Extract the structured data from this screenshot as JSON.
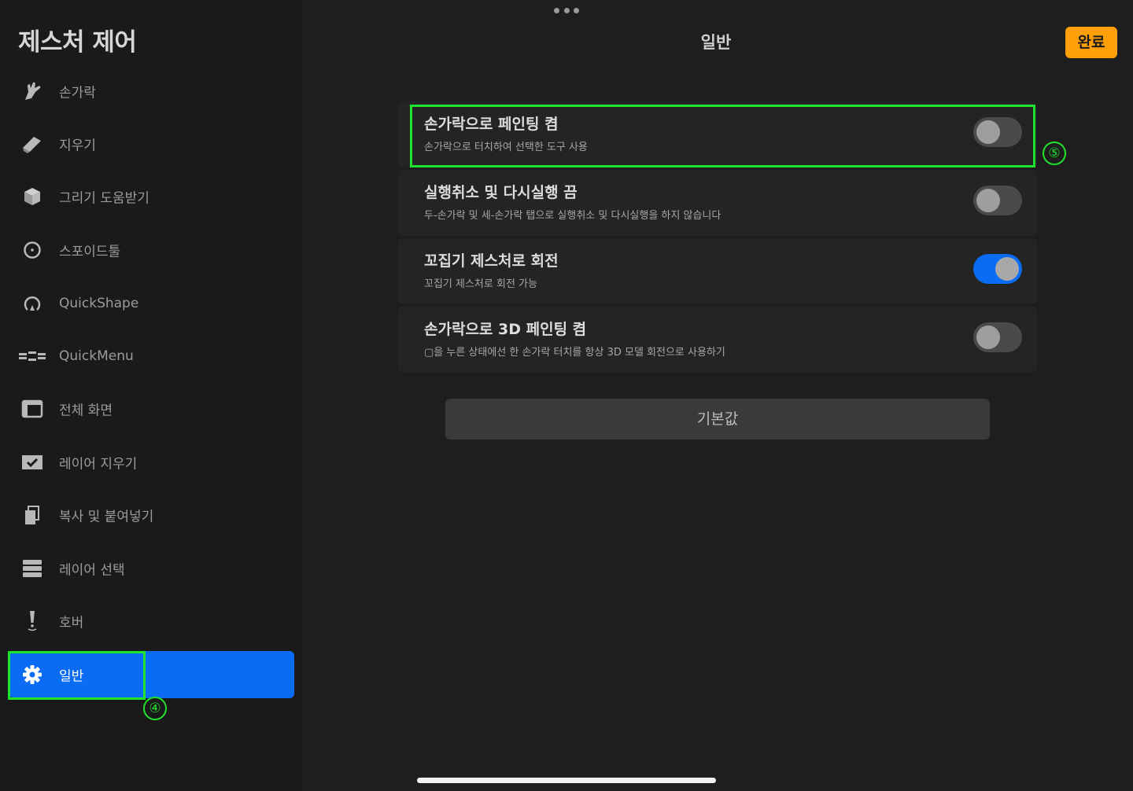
{
  "sidebar": {
    "title": "제스처 제어",
    "items": [
      {
        "label": "손가락",
        "icon": "finger-icon"
      },
      {
        "label": "지우기",
        "icon": "eraser-icon"
      },
      {
        "label": "그리기 도움받기",
        "icon": "cube-icon"
      },
      {
        "label": "스포이드툴",
        "icon": "eyedropper-circle-icon"
      },
      {
        "label": "QuickShape",
        "icon": "quickshape-icon"
      },
      {
        "label": "QuickMenu",
        "icon": "quickmenu-icon"
      },
      {
        "label": "전체 화면",
        "icon": "fullscreen-icon"
      },
      {
        "label": "레이어 지우기",
        "icon": "clear-layer-icon"
      },
      {
        "label": "복사 및 붙여넣기",
        "icon": "copy-paste-icon"
      },
      {
        "label": "레이어 선택",
        "icon": "layers-icon"
      },
      {
        "label": "호버",
        "icon": "hover-pencil-icon"
      },
      {
        "label": "일반",
        "icon": "gear-icon",
        "active": true
      }
    ]
  },
  "header": {
    "title": "일반",
    "done_label": "완료"
  },
  "settings": [
    {
      "title": "손가락으로 페인팅 켬",
      "description": "손가락으로 터치하여 선택한 도구 사용",
      "on": false
    },
    {
      "title": "실행취소 및 다시실행 끔",
      "description": "두-손가락 및 세-손가락 탭으로 실행취소 및 다시실행을 하지 않습니다",
      "on": false
    },
    {
      "title": "꼬집기 제스처로 회전",
      "description": "꼬집기 제스처로 회전 가능",
      "on": true
    },
    {
      "title": "손가락으로 3D 페인팅 켬",
      "description": "▢을 누른 상태에선 한 손가락 터치를 항상 3D 모델 회전으로 사용하기",
      "on": false
    }
  ],
  "defaults_label": "기본값",
  "annotations": {
    "sidebar_marker": "④",
    "row_marker": "⑤"
  },
  "colors": {
    "accent_blue": "#0a6cf5",
    "done_orange": "#ff9f0a",
    "highlight_green": "#1ee52b"
  }
}
